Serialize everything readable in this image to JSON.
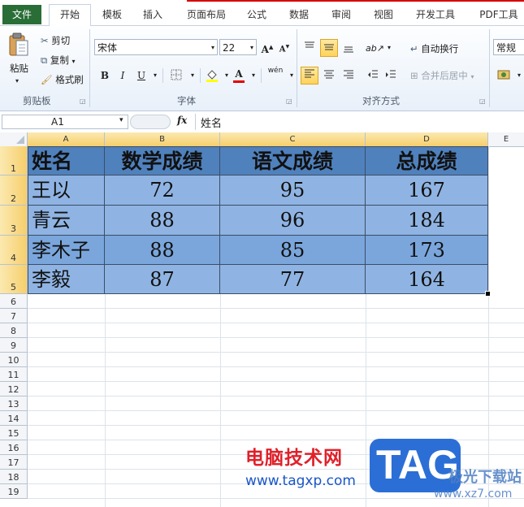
{
  "tabs": [
    "文件",
    "开始",
    "模板",
    "插入",
    "页面布局",
    "公式",
    "数据",
    "审阅",
    "视图",
    "开发工具",
    "PDF工具"
  ],
  "ribbon": {
    "paste": "粘贴",
    "cut": "剪切",
    "copy": "复制",
    "format_painter": "格式刷",
    "clipboard_group": "剪贴板",
    "font_name": "宋体",
    "font_size": "22",
    "font_group": "字体",
    "wrap_text": "自动换行",
    "merge_center": "合并后居中",
    "align_group": "对齐方式",
    "number_format": "常规",
    "bold": "B",
    "italic": "I",
    "underline": "U",
    "grow_font": "A",
    "shrink_font": "A",
    "phonetic": "wén"
  },
  "formula_bar": {
    "name_box": "A1",
    "fx": "fx",
    "content": "姓名"
  },
  "columns": [
    "A",
    "B",
    "C",
    "D",
    "E"
  ],
  "rows": [
    "1",
    "2",
    "3",
    "4",
    "5",
    "6",
    "7",
    "8",
    "9",
    "10",
    "11",
    "12",
    "13",
    "14",
    "15",
    "16",
    "17",
    "18",
    "19"
  ],
  "table": {
    "header": [
      "姓名",
      "数学成绩",
      "语文成绩",
      "总成绩"
    ],
    "rows": [
      [
        "王以",
        "72",
        "95",
        "167"
      ],
      [
        "青云",
        "88",
        "96",
        "184"
      ],
      [
        "李木子",
        "88",
        "85",
        "173"
      ],
      [
        "李毅",
        "87",
        "77",
        "164"
      ]
    ]
  },
  "watermark": {
    "site_name": "电脑技术网",
    "site_url": "www.tagxp.com",
    "logo_text": "TAG",
    "partner_name": "极光下载站",
    "partner_url": "www.xz7.com"
  }
}
